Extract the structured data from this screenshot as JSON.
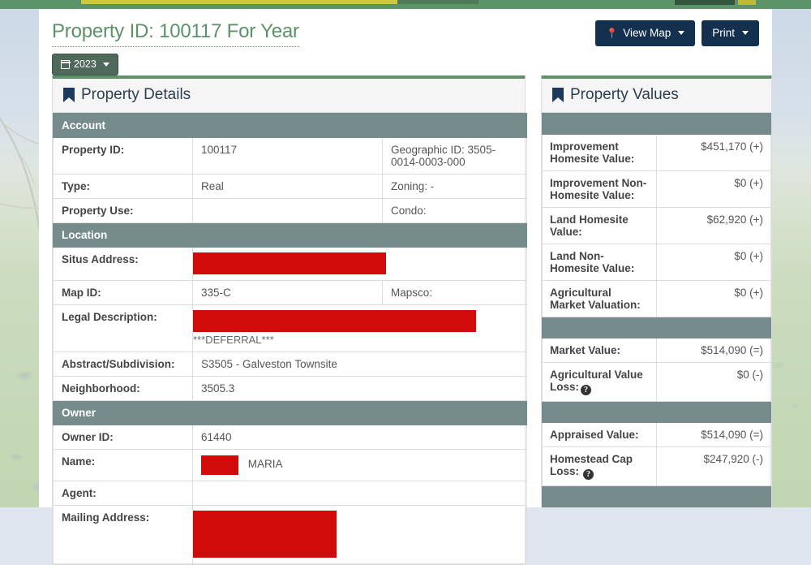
{
  "header": {
    "title": "Property ID: 100117 For Year",
    "year_button": "2023",
    "view_map_button": "View Map",
    "print_button": "Print"
  },
  "details_panel": {
    "heading": "Property Details",
    "sections": [
      {
        "name": "Account",
        "rows": [
          {
            "label": "Property ID:",
            "value": "100117",
            "right": "Geographic ID: 3505-0014-0003-000"
          },
          {
            "label": "Type:",
            "value": "Real",
            "right": "Zoning: -"
          },
          {
            "label": "Property Use:",
            "value": "",
            "right": "Condo:"
          }
        ]
      },
      {
        "name": "Location",
        "rows": [
          {
            "label": "Situs Address:",
            "value": "",
            "right": "",
            "redacted": true
          },
          {
            "label": "Map ID:",
            "value": "335-C",
            "right": "Mapsco:"
          },
          {
            "label": "Legal Description:",
            "value": "***DEFERRAL***",
            "right": "",
            "redacted": true
          },
          {
            "label": "Abstract/Subdivision:",
            "value": "S3505 - Galveston Townsite",
            "right": ""
          },
          {
            "label": "Neighborhood:",
            "value": "3505.3",
            "right": ""
          }
        ]
      },
      {
        "name": "Owner",
        "rows": [
          {
            "label": "Owner ID:",
            "value": "61440",
            "right": ""
          },
          {
            "label": "Name:",
            "value": "MARIA",
            "right": "",
            "redacted_inline": true
          },
          {
            "label": "Agent:",
            "value": "",
            "right": ""
          },
          {
            "label": "Mailing Address:",
            "value": "",
            "right": "",
            "redacted": true
          }
        ]
      }
    ]
  },
  "values_panel": {
    "heading": "Property Values",
    "rows": [
      {
        "label": "Improvement Homesite Value:",
        "value": "$451,170 (+)"
      },
      {
        "label": "Improvement Non-Homesite Value:",
        "value": "$0 (+)"
      },
      {
        "label": "Land Homesite Value:",
        "value": "$62,920 (+)"
      },
      {
        "label": "Land Non-Homesite Value:",
        "value": "$0 (+)"
      },
      {
        "label": "Agricultural Market Valuation:",
        "value": "$0 (+)"
      },
      {
        "label": "Market Value:",
        "value": "$514,090 (=)"
      },
      {
        "label": "Agricultural Value Loss:",
        "value": "$0 (-)",
        "help": true
      },
      {
        "label": "Appraised Value:",
        "value": "$514,090 (=)"
      },
      {
        "label": "Homestead Cap Loss:",
        "value": "$247,920 (-)",
        "help": true
      }
    ]
  },
  "colors": {
    "brand_green": "#5b9268",
    "section_gray": "#768b8b",
    "button_dark": "#13304f",
    "redaction_red": "#d10a0a"
  }
}
